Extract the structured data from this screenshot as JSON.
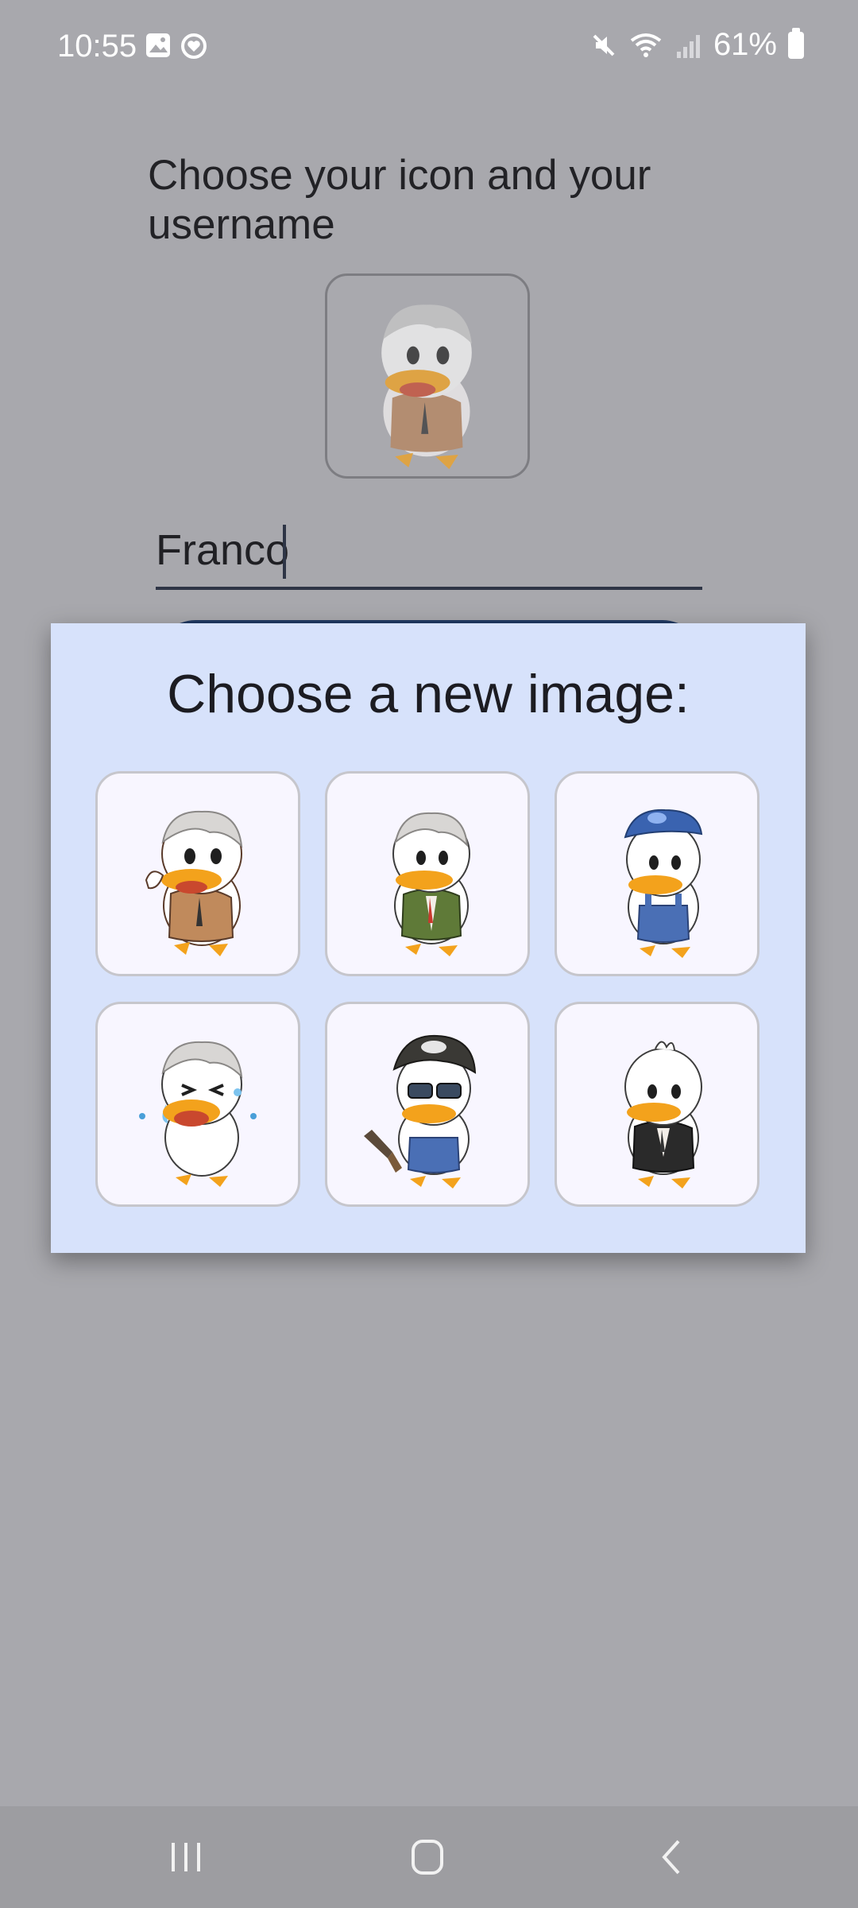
{
  "status_bar": {
    "time": "10:55",
    "battery": "61%",
    "icons": [
      "image-icon",
      "heart-circle-icon",
      "mute-icon",
      "wifi-icon",
      "signal-icon",
      "battery-icon"
    ]
  },
  "page": {
    "title": "Choose your icon and your username",
    "username_value": "Franco",
    "selected_icon": "duck-brown-coat"
  },
  "dialog": {
    "title": "Choose a new image:",
    "options": [
      {
        "id": "duck-brown-coat",
        "icon": "duck-brown-coat-icon"
      },
      {
        "id": "duck-green-jacket",
        "icon": "duck-green-jacket-icon"
      },
      {
        "id": "duck-blue-cap-overalls",
        "icon": "duck-blue-cap-overalls-icon"
      },
      {
        "id": "duck-crying",
        "icon": "duck-crying-icon"
      },
      {
        "id": "duck-sunglasses-gun",
        "icon": "duck-sunglasses-gun-icon"
      },
      {
        "id": "duck-black-suit",
        "icon": "duck-black-suit-icon"
      }
    ]
  },
  "colors": {
    "scrim": "#a8a8ad",
    "dialog_bg": "#d7e2fb",
    "tile_bg": "#f8f6ff",
    "underline": "#2e3546",
    "duck_bill": "#f3a21c"
  }
}
